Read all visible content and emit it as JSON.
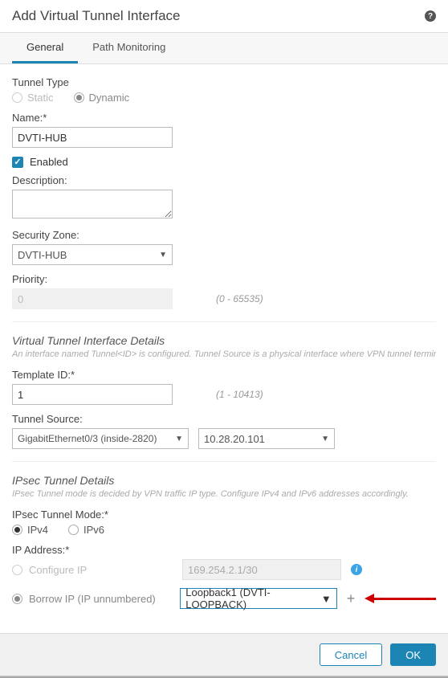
{
  "header": {
    "title": "Add Virtual Tunnel Interface"
  },
  "tabs": {
    "general": "General",
    "path": "Path Monitoring"
  },
  "tunnel_type": {
    "label": "Tunnel Type",
    "static": "Static",
    "dynamic": "Dynamic"
  },
  "name": {
    "label": "Name:*",
    "value": "DVTI-HUB"
  },
  "enabled": {
    "label": "Enabled"
  },
  "description": {
    "label": "Description:",
    "value": ""
  },
  "security_zone": {
    "label": "Security Zone:",
    "value": "DVTI-HUB"
  },
  "priority": {
    "label": "Priority:",
    "value": "0",
    "hint": "(0 - 65535)"
  },
  "vti_section": {
    "title": "Virtual Tunnel Interface Details",
    "sub": "An interface named Tunnel<ID> is configured. Tunnel Source is a physical interface where VPN tunnel terminates for the VTI"
  },
  "template_id": {
    "label": "Template ID:*",
    "value": "1",
    "hint": "(1 - 10413)"
  },
  "tunnel_source": {
    "label": "Tunnel Source:",
    "iface": "GigabitEthernet0/3 (inside-2820)",
    "ip": "10.28.20.101"
  },
  "ipsec_section": {
    "title": "IPsec Tunnel Details",
    "sub": "IPsec Tunnel mode is decided by VPN traffic IP type. Configure IPv4 and IPv6 addresses accordingly."
  },
  "ipsec_mode": {
    "label": "IPsec Tunnel Mode:*",
    "v4": "IPv4",
    "v6": "IPv6"
  },
  "ip_address": {
    "label": "IP Address:*",
    "configure": "Configure IP",
    "configure_value": "169.254.2.1/30",
    "borrow": "Borrow IP (IP unnumbered)",
    "borrow_value": "Loopback1 (DVTI-LOOPBACK)"
  },
  "footer": {
    "cancel": "Cancel",
    "ok": "OK"
  }
}
